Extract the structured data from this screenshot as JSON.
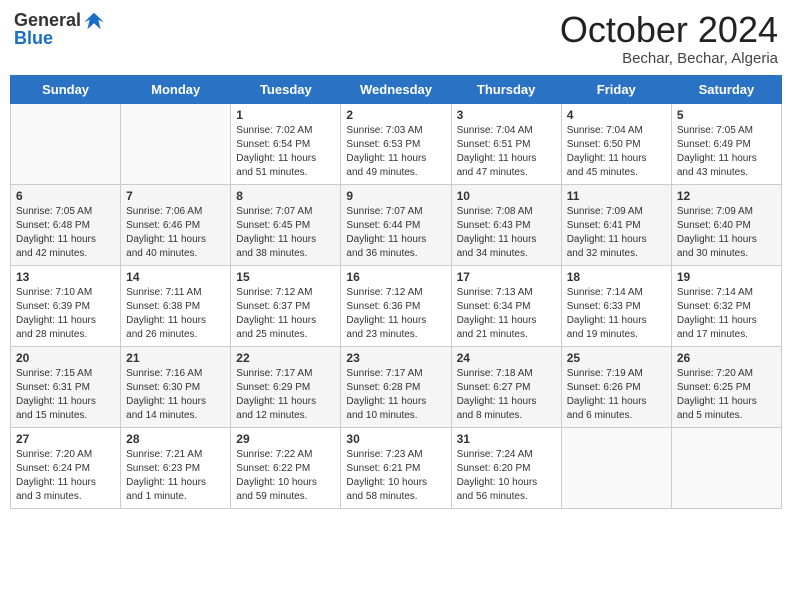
{
  "header": {
    "logo_line1": "General",
    "logo_line2": "Blue",
    "month": "October 2024",
    "location": "Bechar, Bechar, Algeria"
  },
  "days_of_week": [
    "Sunday",
    "Monday",
    "Tuesday",
    "Wednesday",
    "Thursday",
    "Friday",
    "Saturday"
  ],
  "weeks": [
    [
      {
        "day": "",
        "sunrise": "",
        "sunset": "",
        "daylight": ""
      },
      {
        "day": "",
        "sunrise": "",
        "sunset": "",
        "daylight": ""
      },
      {
        "day": "1",
        "sunrise": "Sunrise: 7:02 AM",
        "sunset": "Sunset: 6:54 PM",
        "daylight": "Daylight: 11 hours and 51 minutes."
      },
      {
        "day": "2",
        "sunrise": "Sunrise: 7:03 AM",
        "sunset": "Sunset: 6:53 PM",
        "daylight": "Daylight: 11 hours and 49 minutes."
      },
      {
        "day": "3",
        "sunrise": "Sunrise: 7:04 AM",
        "sunset": "Sunset: 6:51 PM",
        "daylight": "Daylight: 11 hours and 47 minutes."
      },
      {
        "day": "4",
        "sunrise": "Sunrise: 7:04 AM",
        "sunset": "Sunset: 6:50 PM",
        "daylight": "Daylight: 11 hours and 45 minutes."
      },
      {
        "day": "5",
        "sunrise": "Sunrise: 7:05 AM",
        "sunset": "Sunset: 6:49 PM",
        "daylight": "Daylight: 11 hours and 43 minutes."
      }
    ],
    [
      {
        "day": "6",
        "sunrise": "Sunrise: 7:05 AM",
        "sunset": "Sunset: 6:48 PM",
        "daylight": "Daylight: 11 hours and 42 minutes."
      },
      {
        "day": "7",
        "sunrise": "Sunrise: 7:06 AM",
        "sunset": "Sunset: 6:46 PM",
        "daylight": "Daylight: 11 hours and 40 minutes."
      },
      {
        "day": "8",
        "sunrise": "Sunrise: 7:07 AM",
        "sunset": "Sunset: 6:45 PM",
        "daylight": "Daylight: 11 hours and 38 minutes."
      },
      {
        "day": "9",
        "sunrise": "Sunrise: 7:07 AM",
        "sunset": "Sunset: 6:44 PM",
        "daylight": "Daylight: 11 hours and 36 minutes."
      },
      {
        "day": "10",
        "sunrise": "Sunrise: 7:08 AM",
        "sunset": "Sunset: 6:43 PM",
        "daylight": "Daylight: 11 hours and 34 minutes."
      },
      {
        "day": "11",
        "sunrise": "Sunrise: 7:09 AM",
        "sunset": "Sunset: 6:41 PM",
        "daylight": "Daylight: 11 hours and 32 minutes."
      },
      {
        "day": "12",
        "sunrise": "Sunrise: 7:09 AM",
        "sunset": "Sunset: 6:40 PM",
        "daylight": "Daylight: 11 hours and 30 minutes."
      }
    ],
    [
      {
        "day": "13",
        "sunrise": "Sunrise: 7:10 AM",
        "sunset": "Sunset: 6:39 PM",
        "daylight": "Daylight: 11 hours and 28 minutes."
      },
      {
        "day": "14",
        "sunrise": "Sunrise: 7:11 AM",
        "sunset": "Sunset: 6:38 PM",
        "daylight": "Daylight: 11 hours and 26 minutes."
      },
      {
        "day": "15",
        "sunrise": "Sunrise: 7:12 AM",
        "sunset": "Sunset: 6:37 PM",
        "daylight": "Daylight: 11 hours and 25 minutes."
      },
      {
        "day": "16",
        "sunrise": "Sunrise: 7:12 AM",
        "sunset": "Sunset: 6:36 PM",
        "daylight": "Daylight: 11 hours and 23 minutes."
      },
      {
        "day": "17",
        "sunrise": "Sunrise: 7:13 AM",
        "sunset": "Sunset: 6:34 PM",
        "daylight": "Daylight: 11 hours and 21 minutes."
      },
      {
        "day": "18",
        "sunrise": "Sunrise: 7:14 AM",
        "sunset": "Sunset: 6:33 PM",
        "daylight": "Daylight: 11 hours and 19 minutes."
      },
      {
        "day": "19",
        "sunrise": "Sunrise: 7:14 AM",
        "sunset": "Sunset: 6:32 PM",
        "daylight": "Daylight: 11 hours and 17 minutes."
      }
    ],
    [
      {
        "day": "20",
        "sunrise": "Sunrise: 7:15 AM",
        "sunset": "Sunset: 6:31 PM",
        "daylight": "Daylight: 11 hours and 15 minutes."
      },
      {
        "day": "21",
        "sunrise": "Sunrise: 7:16 AM",
        "sunset": "Sunset: 6:30 PM",
        "daylight": "Daylight: 11 hours and 14 minutes."
      },
      {
        "day": "22",
        "sunrise": "Sunrise: 7:17 AM",
        "sunset": "Sunset: 6:29 PM",
        "daylight": "Daylight: 11 hours and 12 minutes."
      },
      {
        "day": "23",
        "sunrise": "Sunrise: 7:17 AM",
        "sunset": "Sunset: 6:28 PM",
        "daylight": "Daylight: 11 hours and 10 minutes."
      },
      {
        "day": "24",
        "sunrise": "Sunrise: 7:18 AM",
        "sunset": "Sunset: 6:27 PM",
        "daylight": "Daylight: 11 hours and 8 minutes."
      },
      {
        "day": "25",
        "sunrise": "Sunrise: 7:19 AM",
        "sunset": "Sunset: 6:26 PM",
        "daylight": "Daylight: 11 hours and 6 minutes."
      },
      {
        "day": "26",
        "sunrise": "Sunrise: 7:20 AM",
        "sunset": "Sunset: 6:25 PM",
        "daylight": "Daylight: 11 hours and 5 minutes."
      }
    ],
    [
      {
        "day": "27",
        "sunrise": "Sunrise: 7:20 AM",
        "sunset": "Sunset: 6:24 PM",
        "daylight": "Daylight: 11 hours and 3 minutes."
      },
      {
        "day": "28",
        "sunrise": "Sunrise: 7:21 AM",
        "sunset": "Sunset: 6:23 PM",
        "daylight": "Daylight: 11 hours and 1 minute."
      },
      {
        "day": "29",
        "sunrise": "Sunrise: 7:22 AM",
        "sunset": "Sunset: 6:22 PM",
        "daylight": "Daylight: 10 hours and 59 minutes."
      },
      {
        "day": "30",
        "sunrise": "Sunrise: 7:23 AM",
        "sunset": "Sunset: 6:21 PM",
        "daylight": "Daylight: 10 hours and 58 minutes."
      },
      {
        "day": "31",
        "sunrise": "Sunrise: 7:24 AM",
        "sunset": "Sunset: 6:20 PM",
        "daylight": "Daylight: 10 hours and 56 minutes."
      },
      {
        "day": "",
        "sunrise": "",
        "sunset": "",
        "daylight": ""
      },
      {
        "day": "",
        "sunrise": "",
        "sunset": "",
        "daylight": ""
      }
    ]
  ]
}
